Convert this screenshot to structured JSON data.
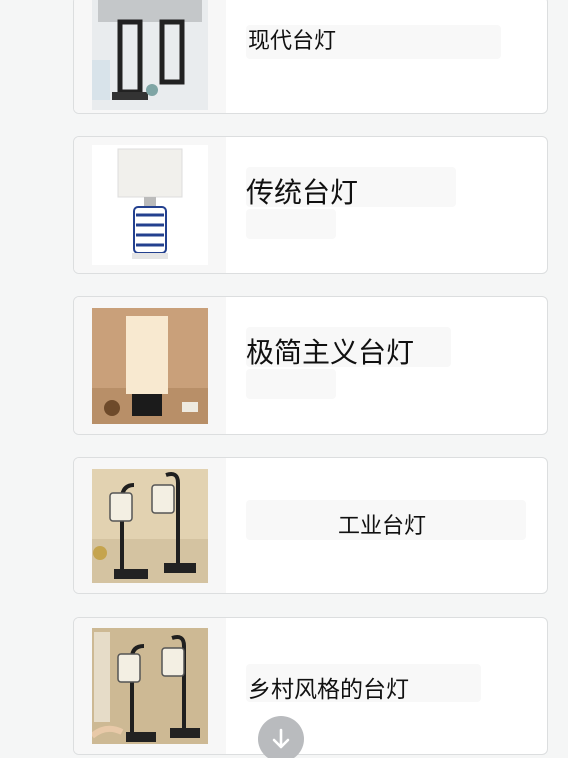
{
  "items": [
    {
      "label": "现代台灯",
      "icon": "modern-lamp-image"
    },
    {
      "label": "传统台灯",
      "icon": "traditional-lamp-image"
    },
    {
      "label": "极简主义台灯",
      "icon": "minimalist-lamp-image"
    },
    {
      "label": "工业台灯",
      "icon": "industrial-lamp-image"
    },
    {
      "label": "乡村风格的台灯",
      "icon": "rustic-lamp-image"
    }
  ],
  "scroll_button": {
    "icon": "arrow-down-icon"
  },
  "colors": {
    "background": "#f5f6f6",
    "card": "#ffffff",
    "border": "#dcdedf",
    "scroll": "#b9bbbe"
  }
}
